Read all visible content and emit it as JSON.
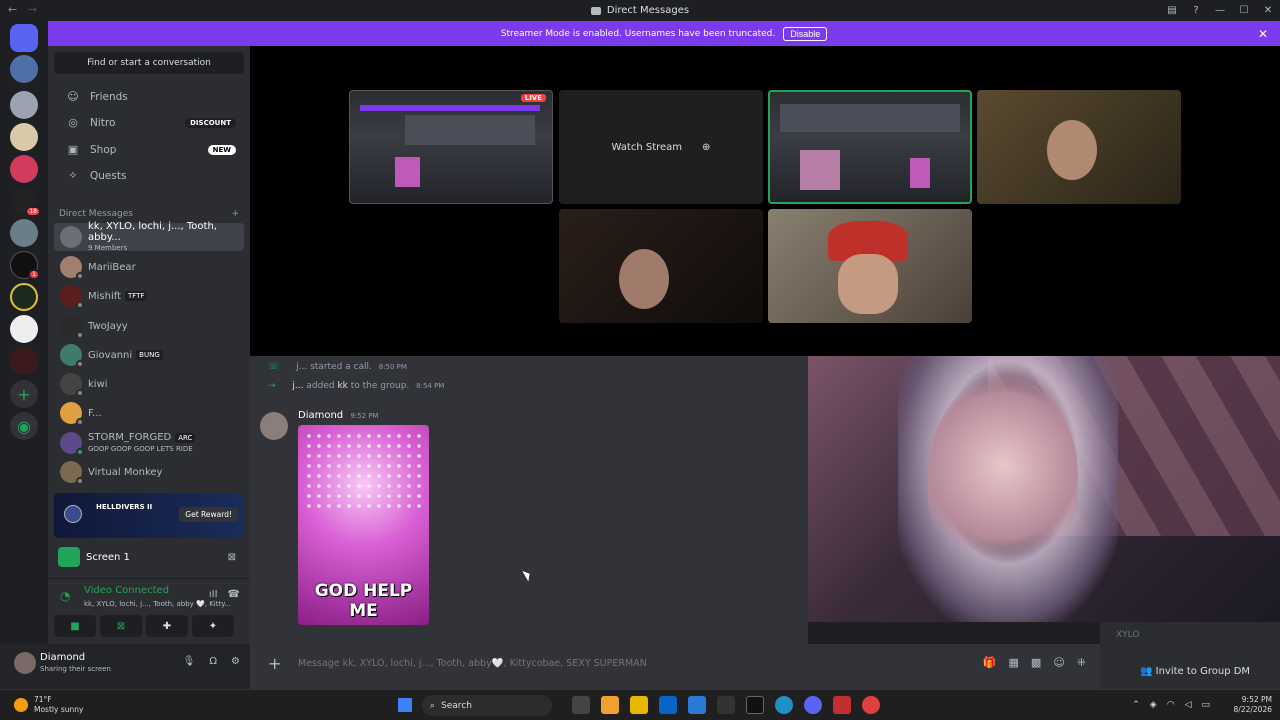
{
  "window": {
    "title": "Direct Messages"
  },
  "banner": {
    "text": "Streamer Mode is enabled. Usernames have been truncated.",
    "disable_label": "Disable"
  },
  "sidebar": {
    "find_label": "Find or start a conversation",
    "nav": [
      {
        "label": "Friends",
        "icon": "friends-icon"
      },
      {
        "label": "Nitro",
        "icon": "nitro-icon",
        "pill": "DISCOUNT"
      },
      {
        "label": "Shop",
        "icon": "shop-icon",
        "pill": "NEW"
      },
      {
        "label": "Quests",
        "icon": "quests-icon"
      }
    ],
    "dm_header": "Direct Messages",
    "dms": [
      {
        "name": "kk, XYLO, lochi, j..., Tooth, abby...",
        "sub": "9 Members"
      },
      {
        "name": "MariiBear"
      },
      {
        "name": "Mishift",
        "tag": "TFTF"
      },
      {
        "name": "TwoJayy"
      },
      {
        "name": "Giovanni",
        "tag": "BUNG"
      },
      {
        "name": "kiwi"
      },
      {
        "name": "F..."
      },
      {
        "name": "STORM_FORGED",
        "tag": "ARC",
        "sub": "GOOP GOOP GOOP LETS RIDE"
      },
      {
        "name": "Virtual Monkey"
      }
    ],
    "promo": {
      "logo": "HELLDIVERS II",
      "button": "Get Reward!"
    },
    "screen": {
      "label": "Screen 1"
    },
    "voice": {
      "status": "Video Connected",
      "channel": "kk, XYLO, lochi, j..., Tooth, abby 🤍, Kitty..."
    },
    "user": {
      "name": "Diamond",
      "status": "Sharing their screen"
    }
  },
  "call": {
    "live_label": "LIVE",
    "watch_label": "Watch Stream"
  },
  "chat": {
    "sys1": {
      "text": "j... started a call.",
      "time": "8:50 PM"
    },
    "sys2": {
      "actor": "j...",
      "text": " added ",
      "target": "kk",
      "rest": " to the group.",
      "time": "8:54 PM"
    },
    "message": {
      "author": "Diamond",
      "time": "9:52 PM",
      "gif_caption": "GOD HELP ME"
    },
    "composer_placeholder": "Message kk, XYLO, lochi, j..., Tooth, abby🤍, Kittycobae, SEXY SUPERMAN"
  },
  "rightpanel": {
    "xylo": "XYLO",
    "invite": "Invite to Group DM"
  },
  "taskbar": {
    "temp": "71°F",
    "weather": "Mostly sunny",
    "search": "Search",
    "time": "9:52 PM",
    "date": "8/22/2026"
  }
}
